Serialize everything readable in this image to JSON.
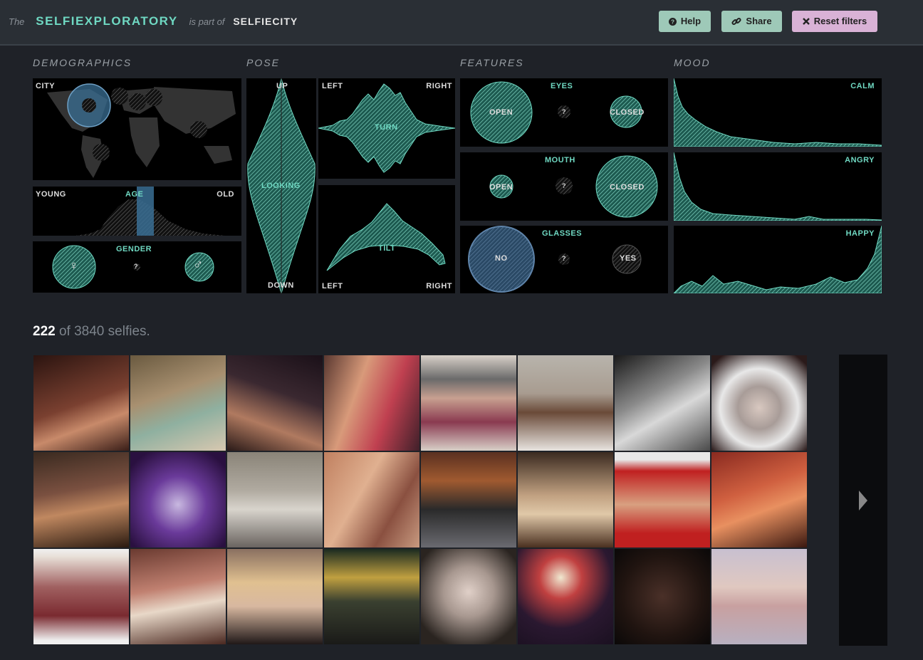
{
  "header": {
    "the": "The",
    "app_name": "SELFIEXPLORATORY",
    "part_of": "is part of",
    "parent_name": "SELFIECITY",
    "help_label": "Help",
    "share_label": "Share",
    "reset_label": "Reset filters"
  },
  "sections": {
    "demographics": "DEMOGRAPHICS",
    "pose": "POSE",
    "features": "FEATURES",
    "mood": "MOOD"
  },
  "demographics": {
    "city": "CITY",
    "age": {
      "title": "AGE",
      "young": "YOUNG",
      "old": "OLD"
    },
    "gender": {
      "title": "GENDER",
      "female": "♀",
      "unknown": "?",
      "male": "♂"
    }
  },
  "pose": {
    "looking": {
      "up": "UP",
      "center": "LOOKING",
      "down": "DOWN"
    },
    "turn": {
      "left": "LEFT",
      "center": "TURN",
      "right": "RIGHT"
    },
    "tilt": {
      "left": "LEFT",
      "center": "TILT",
      "right": "RIGHT"
    }
  },
  "features": {
    "eyes": {
      "title": "EYES",
      "open": "OPEN",
      "unknown": "?",
      "closed": "CLOSED"
    },
    "mouth": {
      "title": "MOUTH",
      "open": "OPEN",
      "unknown": "?",
      "closed": "CLOSED"
    },
    "glasses": {
      "title": "GLASSES",
      "no": "NO",
      "unknown": "?",
      "yes": "YES"
    }
  },
  "mood": {
    "calm": "CALM",
    "angry": "ANGRY",
    "happy": "HAPPY"
  },
  "results": {
    "shown": "222",
    "of_text": "of 3840 selfies."
  },
  "colors": {
    "accent": "#6fd8c2",
    "selection": "#3a6f94",
    "help_btn": "#9ec9b8",
    "reset_btn": "#d9b2d6"
  },
  "icons": {
    "help": "question-circle-icon",
    "share": "link-icon",
    "reset": "close-icon",
    "next": "chevron-right-icon"
  }
}
